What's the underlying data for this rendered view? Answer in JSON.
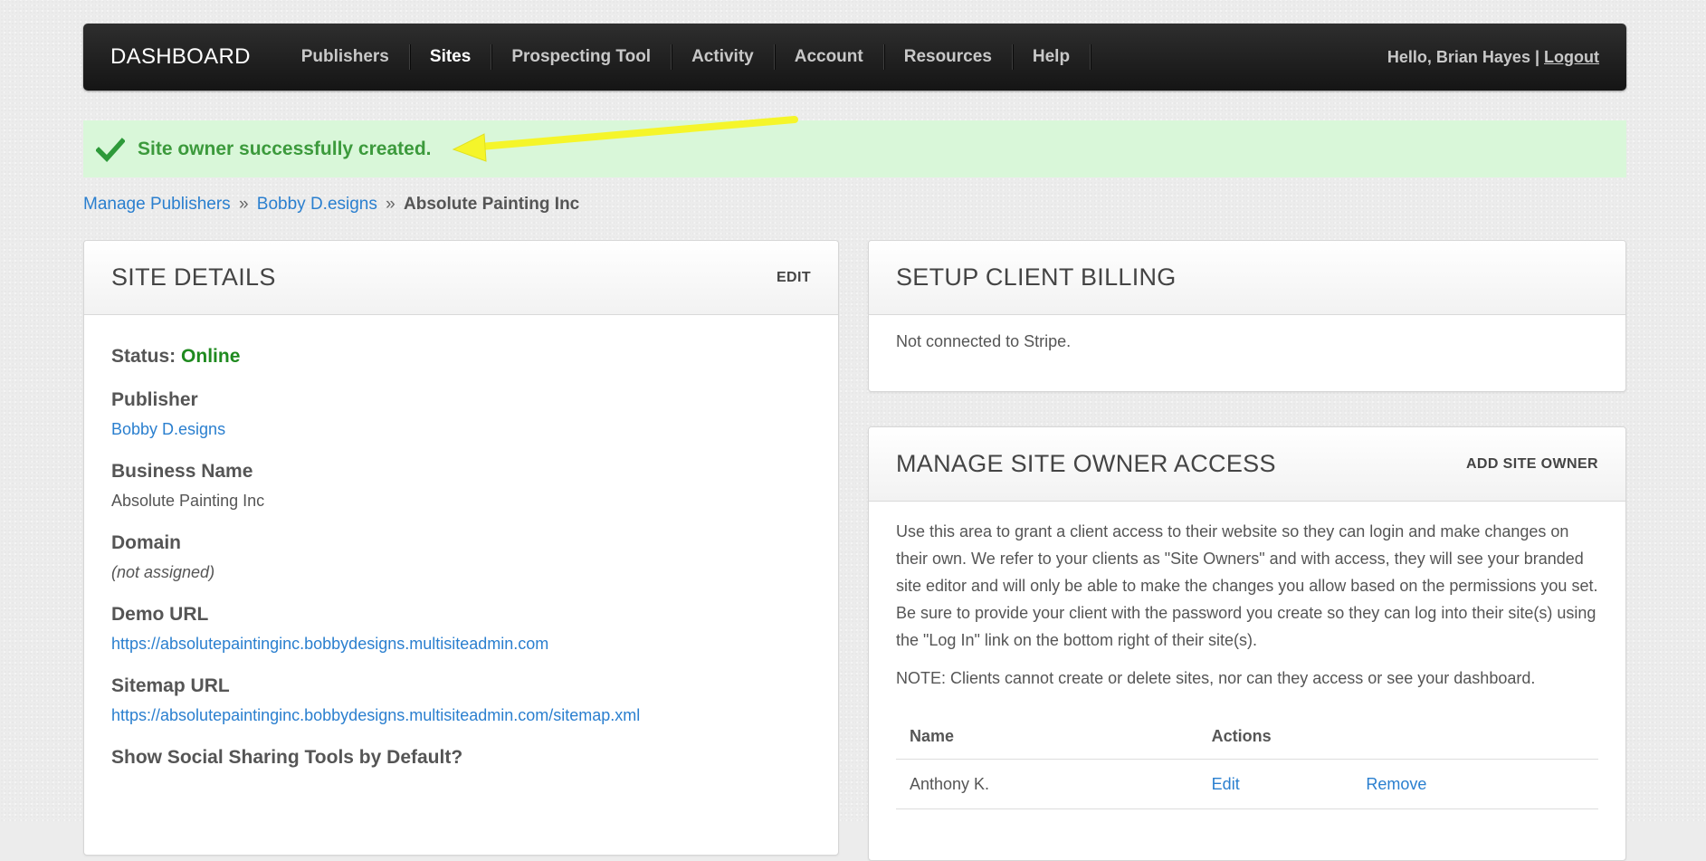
{
  "nav": {
    "brand": "DASHBOARD",
    "items": [
      {
        "label": "Publishers",
        "active": false
      },
      {
        "label": "Sites",
        "active": true
      },
      {
        "label": "Prospecting Tool",
        "active": false
      },
      {
        "label": "Activity",
        "active": false
      },
      {
        "label": "Account",
        "active": false
      },
      {
        "label": "Resources",
        "active": false
      },
      {
        "label": "Help",
        "active": false
      }
    ],
    "greeting": "Hello, Brian Hayes |",
    "logout": "Logout"
  },
  "alert": {
    "message": "Site owner successfully created.",
    "check_icon": "checkmark-icon",
    "color": "#3c9a3c"
  },
  "breadcrumb": {
    "items": [
      "Manage Publishers",
      "Bobby D.esigns"
    ],
    "separator": "»",
    "current": "Absolute Painting Inc"
  },
  "site_details": {
    "title": "SITE DETAILS",
    "edit": "EDIT",
    "status_label": "Status:",
    "status_value": "Online",
    "publisher_label": "Publisher",
    "publisher_value": "Bobby D.esigns",
    "business_label": "Business Name",
    "business_value": "Absolute Painting Inc",
    "domain_label": "Domain",
    "domain_value": "(not assigned)",
    "demo_label": "Demo URL",
    "demo_value": "https://absolutepaintinginc.bobbydesigns.multisiteadmin.com",
    "sitemap_label": "Sitemap URL",
    "sitemap_value": "https://absolutepaintinginc.bobbydesigns.multisiteadmin.com/sitemap.xml",
    "social_label": "Show Social Sharing Tools by Default?"
  },
  "billing": {
    "title": "SETUP CLIENT BILLING",
    "text": "Not connected to Stripe."
  },
  "access": {
    "title": "MANAGE SITE OWNER ACCESS",
    "add": "ADD SITE OWNER",
    "description": "Use this area to grant a client access to their website so they can login and make changes on their own. We refer to your clients as \"Site Owners\" and with access, they will see your branded site editor and will only be able to make the changes you allow based on the permissions you set. Be sure to provide your client with the password you create so they can log into their site(s) using the \"Log In\" link on the bottom right of their site(s).",
    "note": "NOTE: Clients cannot create or delete sites, nor can they access or see your dashboard.",
    "col_name": "Name",
    "col_actions": "Actions",
    "rows": [
      {
        "name": "Anthony K.",
        "edit": "Edit",
        "remove": "Remove"
      }
    ]
  }
}
